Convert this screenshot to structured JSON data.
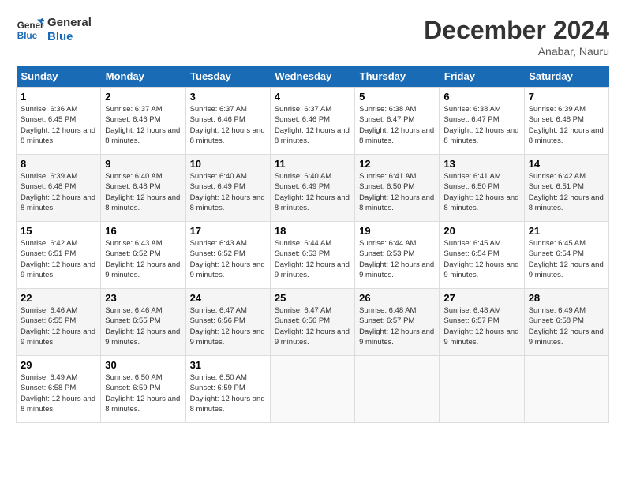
{
  "header": {
    "logo_line1": "General",
    "logo_line2": "Blue",
    "month": "December 2024",
    "location": "Anabar, Nauru"
  },
  "days_of_week": [
    "Sunday",
    "Monday",
    "Tuesday",
    "Wednesday",
    "Thursday",
    "Friday",
    "Saturday"
  ],
  "weeks": [
    [
      {
        "day": "1",
        "sunrise": "6:36 AM",
        "sunset": "6:45 PM",
        "daylight": "12 hours and 8 minutes."
      },
      {
        "day": "2",
        "sunrise": "6:37 AM",
        "sunset": "6:46 PM",
        "daylight": "12 hours and 8 minutes."
      },
      {
        "day": "3",
        "sunrise": "6:37 AM",
        "sunset": "6:46 PM",
        "daylight": "12 hours and 8 minutes."
      },
      {
        "day": "4",
        "sunrise": "6:37 AM",
        "sunset": "6:46 PM",
        "daylight": "12 hours and 8 minutes."
      },
      {
        "day": "5",
        "sunrise": "6:38 AM",
        "sunset": "6:47 PM",
        "daylight": "12 hours and 8 minutes."
      },
      {
        "day": "6",
        "sunrise": "6:38 AM",
        "sunset": "6:47 PM",
        "daylight": "12 hours and 8 minutes."
      },
      {
        "day": "7",
        "sunrise": "6:39 AM",
        "sunset": "6:48 PM",
        "daylight": "12 hours and 8 minutes."
      }
    ],
    [
      {
        "day": "8",
        "sunrise": "6:39 AM",
        "sunset": "6:48 PM",
        "daylight": "12 hours and 8 minutes."
      },
      {
        "day": "9",
        "sunrise": "6:40 AM",
        "sunset": "6:48 PM",
        "daylight": "12 hours and 8 minutes."
      },
      {
        "day": "10",
        "sunrise": "6:40 AM",
        "sunset": "6:49 PM",
        "daylight": "12 hours and 8 minutes."
      },
      {
        "day": "11",
        "sunrise": "6:40 AM",
        "sunset": "6:49 PM",
        "daylight": "12 hours and 8 minutes."
      },
      {
        "day": "12",
        "sunrise": "6:41 AM",
        "sunset": "6:50 PM",
        "daylight": "12 hours and 8 minutes."
      },
      {
        "day": "13",
        "sunrise": "6:41 AM",
        "sunset": "6:50 PM",
        "daylight": "12 hours and 8 minutes."
      },
      {
        "day": "14",
        "sunrise": "6:42 AM",
        "sunset": "6:51 PM",
        "daylight": "12 hours and 8 minutes."
      }
    ],
    [
      {
        "day": "15",
        "sunrise": "6:42 AM",
        "sunset": "6:51 PM",
        "daylight": "12 hours and 9 minutes."
      },
      {
        "day": "16",
        "sunrise": "6:43 AM",
        "sunset": "6:52 PM",
        "daylight": "12 hours and 9 minutes."
      },
      {
        "day": "17",
        "sunrise": "6:43 AM",
        "sunset": "6:52 PM",
        "daylight": "12 hours and 9 minutes."
      },
      {
        "day": "18",
        "sunrise": "6:44 AM",
        "sunset": "6:53 PM",
        "daylight": "12 hours and 9 minutes."
      },
      {
        "day": "19",
        "sunrise": "6:44 AM",
        "sunset": "6:53 PM",
        "daylight": "12 hours and 9 minutes."
      },
      {
        "day": "20",
        "sunrise": "6:45 AM",
        "sunset": "6:54 PM",
        "daylight": "12 hours and 9 minutes."
      },
      {
        "day": "21",
        "sunrise": "6:45 AM",
        "sunset": "6:54 PM",
        "daylight": "12 hours and 9 minutes."
      }
    ],
    [
      {
        "day": "22",
        "sunrise": "6:46 AM",
        "sunset": "6:55 PM",
        "daylight": "12 hours and 9 minutes."
      },
      {
        "day": "23",
        "sunrise": "6:46 AM",
        "sunset": "6:55 PM",
        "daylight": "12 hours and 9 minutes."
      },
      {
        "day": "24",
        "sunrise": "6:47 AM",
        "sunset": "6:56 PM",
        "daylight": "12 hours and 9 minutes."
      },
      {
        "day": "25",
        "sunrise": "6:47 AM",
        "sunset": "6:56 PM",
        "daylight": "12 hours and 9 minutes."
      },
      {
        "day": "26",
        "sunrise": "6:48 AM",
        "sunset": "6:57 PM",
        "daylight": "12 hours and 9 minutes."
      },
      {
        "day": "27",
        "sunrise": "6:48 AM",
        "sunset": "6:57 PM",
        "daylight": "12 hours and 9 minutes."
      },
      {
        "day": "28",
        "sunrise": "6:49 AM",
        "sunset": "6:58 PM",
        "daylight": "12 hours and 9 minutes."
      }
    ],
    [
      {
        "day": "29",
        "sunrise": "6:49 AM",
        "sunset": "6:58 PM",
        "daylight": "12 hours and 8 minutes."
      },
      {
        "day": "30",
        "sunrise": "6:50 AM",
        "sunset": "6:59 PM",
        "daylight": "12 hours and 8 minutes."
      },
      {
        "day": "31",
        "sunrise": "6:50 AM",
        "sunset": "6:59 PM",
        "daylight": "12 hours and 8 minutes."
      },
      null,
      null,
      null,
      null
    ]
  ]
}
